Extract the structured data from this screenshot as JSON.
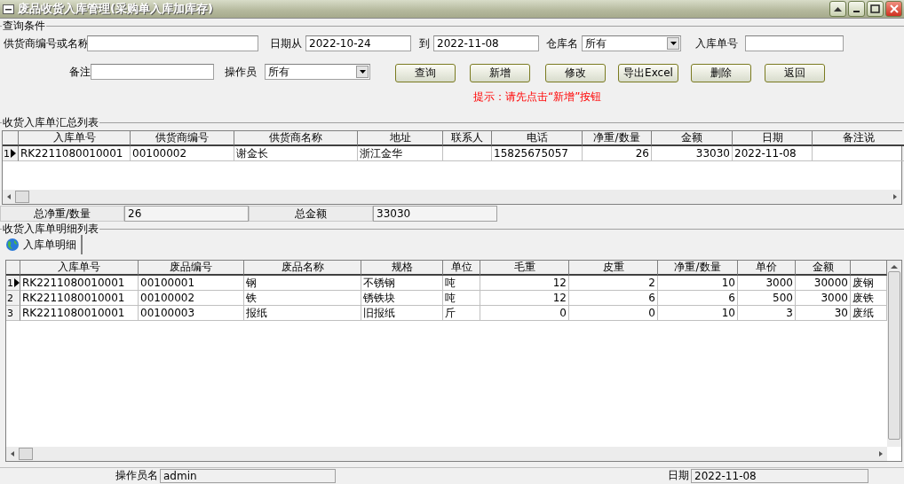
{
  "window": {
    "title": "废品收货入库管理(采购单入库加库存)"
  },
  "query": {
    "title": "查询条件",
    "row_1": [
      {
        "kind": "text",
        "label": "供货商编号或名称"
      },
      {
        "kind": "text",
        "label": "日期从",
        "value": "2022-10-24"
      },
      {
        "kind": "text",
        "label": "到",
        "value": "2022-11-08"
      },
      {
        "kind": "select",
        "label": "仓库名",
        "value": "所有"
      },
      {
        "kind": "text",
        "label": "入库单号"
      }
    ],
    "row_2": [
      {
        "kind": "text",
        "label": "备注"
      },
      {
        "kind": "select",
        "label": "操作员",
        "value": "所有"
      }
    ],
    "buttons": [
      "查询",
      "新增",
      "修改",
      "导出Excel",
      "删除",
      "返回"
    ],
    "hint": "提示：请先点击“新增”按钮"
  },
  "summary": {
    "title": "收货入库单汇总列表",
    "columns": [
      "入库单号",
      "供货商编号",
      "供货商名称",
      "地址",
      "联系人",
      "电话",
      "净重/数量",
      "金额",
      "日期",
      "备注说"
    ],
    "rows": [
      {
        "number": "1",
        "selected": true,
        "cells": [
          "RK2211080010001",
          "00100002",
          "谢金长",
          "浙江金华",
          "",
          "15825675057",
          "26",
          "33030",
          "2022-11-08",
          ""
        ]
      }
    ],
    "totals": [
      {
        "label": "总净重/数量",
        "value": "26"
      },
      {
        "label": "总金额",
        "value": "33030"
      }
    ]
  },
  "detail": {
    "title": "收货入库单明细列表",
    "tabs": [
      {
        "label": "入库单明细",
        "selected": true
      }
    ],
    "columns": [
      "入库单号",
      "废品编号",
      "废品名称",
      "规格",
      "单位",
      "毛重",
      "皮重",
      "净重/数量",
      "单价",
      "金额"
    ],
    "rows": [
      {
        "number": "1",
        "selected": true,
        "cells": [
          "RK2211080010001",
          "00100001",
          "钢",
          "不锈钢",
          "吨",
          "12",
          "2",
          "10",
          "3000",
          "30000",
          "废钢"
        ]
      },
      {
        "number": "2",
        "selected": false,
        "cells": [
          "RK2211080010001",
          "00100002",
          "铁",
          "锈铁块",
          "吨",
          "12",
          "6",
          "6",
          "500",
          "3000",
          "废铁"
        ]
      },
      {
        "number": "3",
        "selected": false,
        "cells": [
          "RK2211080010001",
          "00100003",
          "报纸",
          "旧报纸",
          "斤",
          "0",
          "0",
          "10",
          "3",
          "30",
          "废纸"
        ]
      }
    ]
  },
  "status_bar": [
    {
      "label": "操作员名",
      "value": "admin"
    },
    {
      "label": "日期",
      "value": "2022-11-08"
    }
  ]
}
